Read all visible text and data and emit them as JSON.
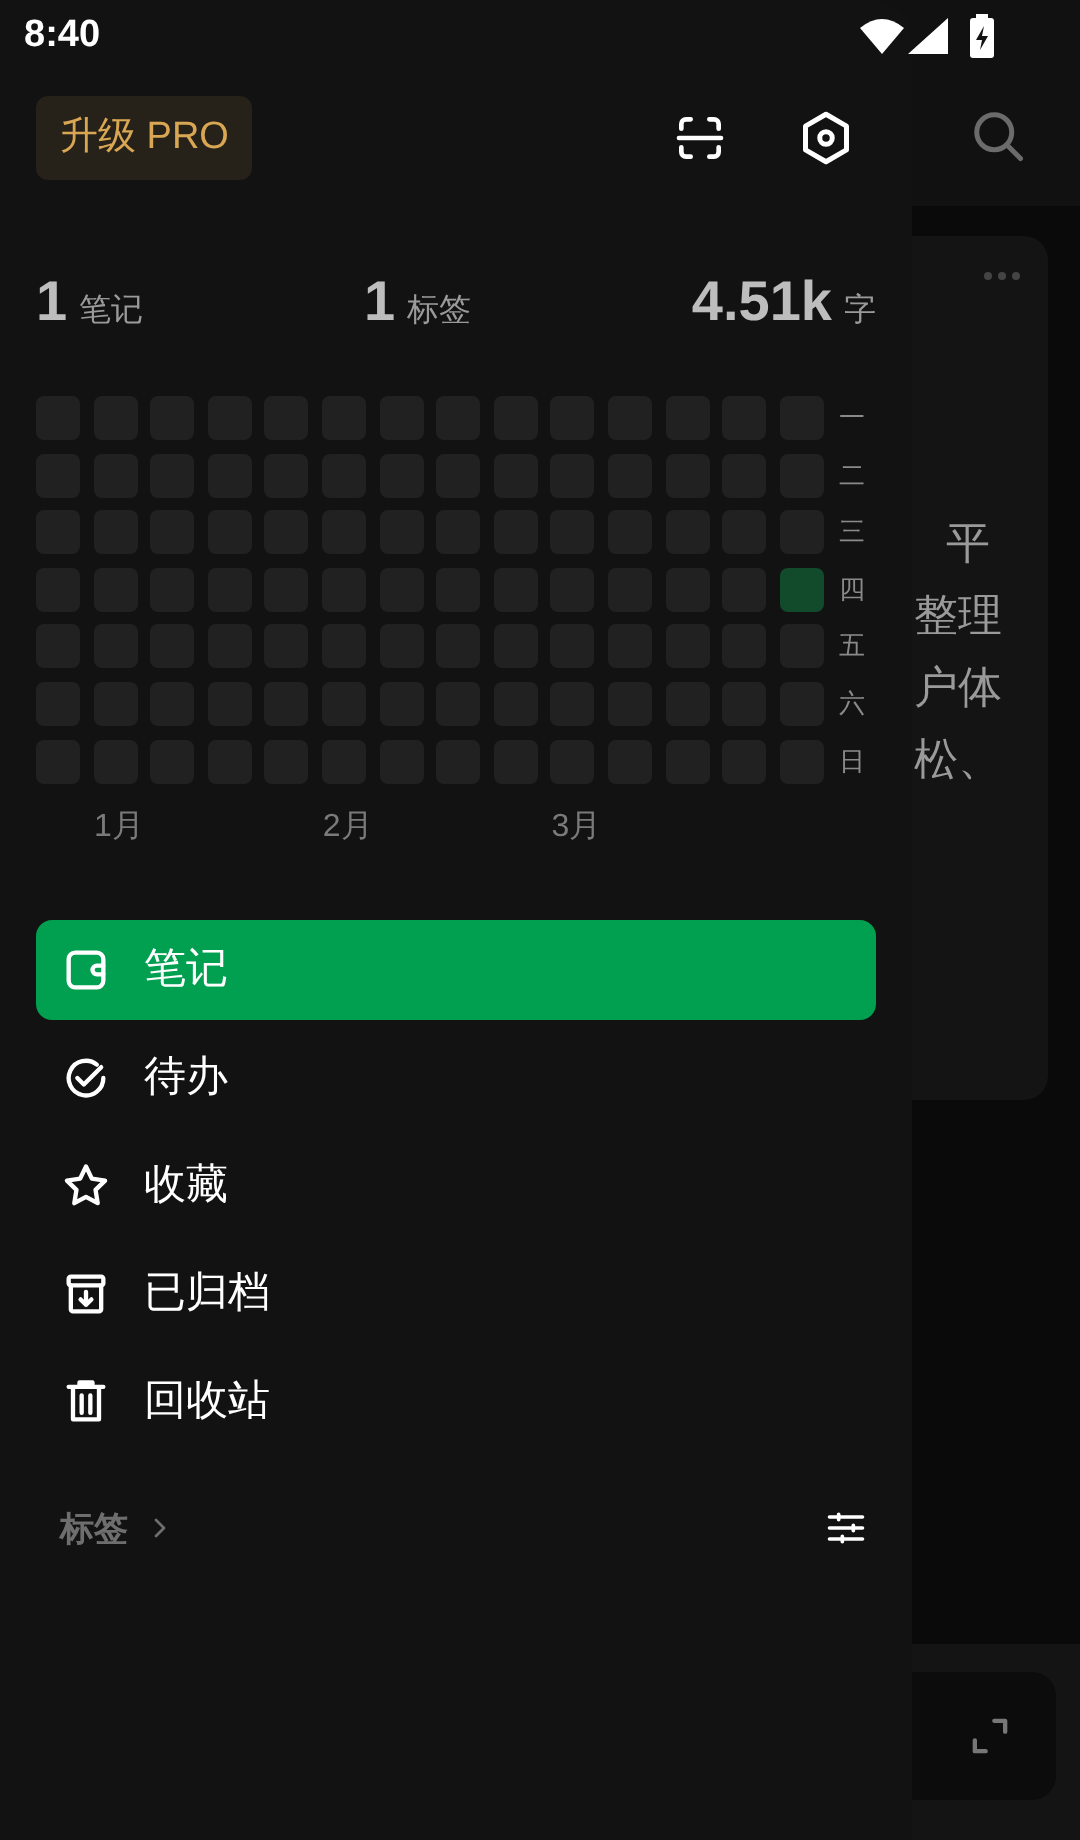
{
  "status_bar": {
    "time": "8:40"
  },
  "background_note": {
    "lines": [
      "平",
      "整理",
      "户体",
      "松、"
    ]
  },
  "drawer": {
    "upgrade_button": "升级 PRO",
    "stats": [
      {
        "value": "1",
        "unit": "笔记"
      },
      {
        "value": "1",
        "unit": "标签"
      },
      {
        "value": "4.51k",
        "unit": "字"
      }
    ],
    "heatmap": {
      "weekdays": [
        "一",
        "二",
        "三",
        "四",
        "五",
        "六",
        "日"
      ],
      "rows": [
        [
          false,
          false,
          false,
          false,
          false,
          false,
          false,
          false,
          false,
          false,
          false,
          false,
          false,
          false
        ],
        [
          false,
          false,
          false,
          false,
          false,
          false,
          false,
          false,
          false,
          false,
          false,
          false,
          false,
          false
        ],
        [
          false,
          false,
          false,
          false,
          false,
          false,
          false,
          false,
          false,
          false,
          false,
          false,
          false,
          false
        ],
        [
          false,
          false,
          false,
          false,
          false,
          false,
          false,
          false,
          false,
          false,
          false,
          false,
          false,
          true
        ],
        [
          false,
          false,
          false,
          false,
          false,
          false,
          false,
          false,
          false,
          false,
          false,
          false,
          false,
          false
        ],
        [
          false,
          false,
          false,
          false,
          false,
          false,
          false,
          false,
          false,
          false,
          false,
          false,
          false,
          false
        ],
        [
          false,
          false,
          false,
          false,
          false,
          false,
          false,
          false,
          false,
          false,
          false,
          false,
          false,
          false
        ]
      ],
      "months": [
        "1月",
        "2月",
        "3月"
      ]
    },
    "menu": [
      {
        "kind": "notes",
        "label": "笔记",
        "selected": true
      },
      {
        "kind": "todo",
        "label": "待办",
        "selected": false
      },
      {
        "kind": "favorites",
        "label": "收藏",
        "selected": false
      },
      {
        "kind": "archive",
        "label": "已归档",
        "selected": false
      },
      {
        "kind": "trash",
        "label": "回收站",
        "selected": false
      }
    ],
    "tags_header": "标签"
  }
}
